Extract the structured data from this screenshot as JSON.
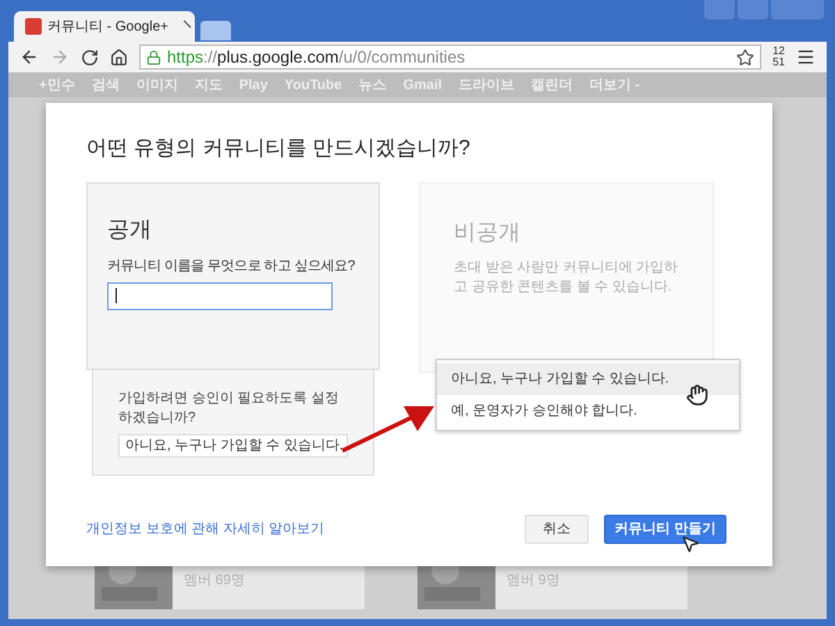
{
  "browser": {
    "tab_title": "커뮤니티 - Google+",
    "url": {
      "scheme": "https",
      "rest": "://",
      "host": "plus.google.com",
      "path": "/u/0/communities"
    },
    "clock": [
      "12",
      "51"
    ]
  },
  "bookmarks": [
    "+민수",
    "검색",
    "이미지",
    "지도",
    "Play",
    "YouTube",
    "뉴스",
    "Gmail",
    "드라이브",
    "캘린더",
    "더보기 -"
  ],
  "background_cards": [
    {
      "members": "멤버 69명"
    },
    {
      "members": "멤버 9명"
    }
  ],
  "dialog": {
    "title": "어떤 유형의 커뮤니티를 만드시겠습니까?",
    "public": {
      "title": "공개",
      "question": "커뮤니티 이름을 무엇으로 하고 싶으세요?",
      "approval_question": "가입하려면 승인이 필요하도록 설정하겠습니까?",
      "approval_value": "아니요, 누구나 가입할 수 있습니다."
    },
    "private": {
      "title": "비공개",
      "description": "초대 받은 사람만 커뮤니티에 가입하고 공유한 콘텐츠를 볼 수 있습니다."
    },
    "dropdown": [
      {
        "label": "아니요, 누구나 가입할 수 있습니다.",
        "selected": true
      },
      {
        "label": "예, 운영자가 승인해야 합니다.",
        "selected": false
      }
    ],
    "privacy_link": "개인정보 보호에 관해 자세히 알아보기",
    "cancel": "취소",
    "create": "커뮤니티 만들기"
  }
}
